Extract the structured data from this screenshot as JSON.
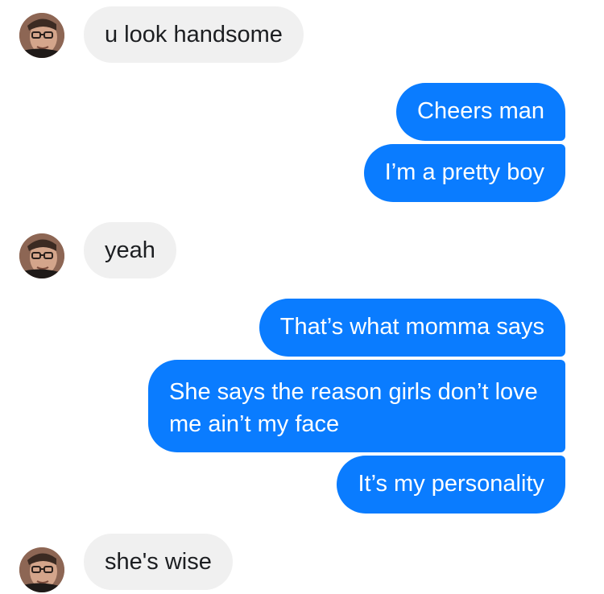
{
  "conversation": {
    "messages": [
      {
        "sender": "them",
        "text": "u look handsome"
      },
      {
        "sender": "me",
        "text": "Cheers man"
      },
      {
        "sender": "me",
        "text": "I’m a pretty boy"
      },
      {
        "sender": "them",
        "text": "yeah"
      },
      {
        "sender": "me",
        "text": "That’s what momma says"
      },
      {
        "sender": "me",
        "text": "She says the reason girls don’t love me ain’t my face"
      },
      {
        "sender": "me",
        "text": "It’s my personality"
      },
      {
        "sender": "them",
        "text": "she's wise"
      }
    ]
  },
  "colors": {
    "outgoing_bubble": "#0a7cff",
    "incoming_bubble": "#f0f0f0",
    "outgoing_text": "#ffffff",
    "incoming_text": "#1c1e21"
  },
  "icons": {
    "contact_avatar": "contact-avatar-photo"
  }
}
